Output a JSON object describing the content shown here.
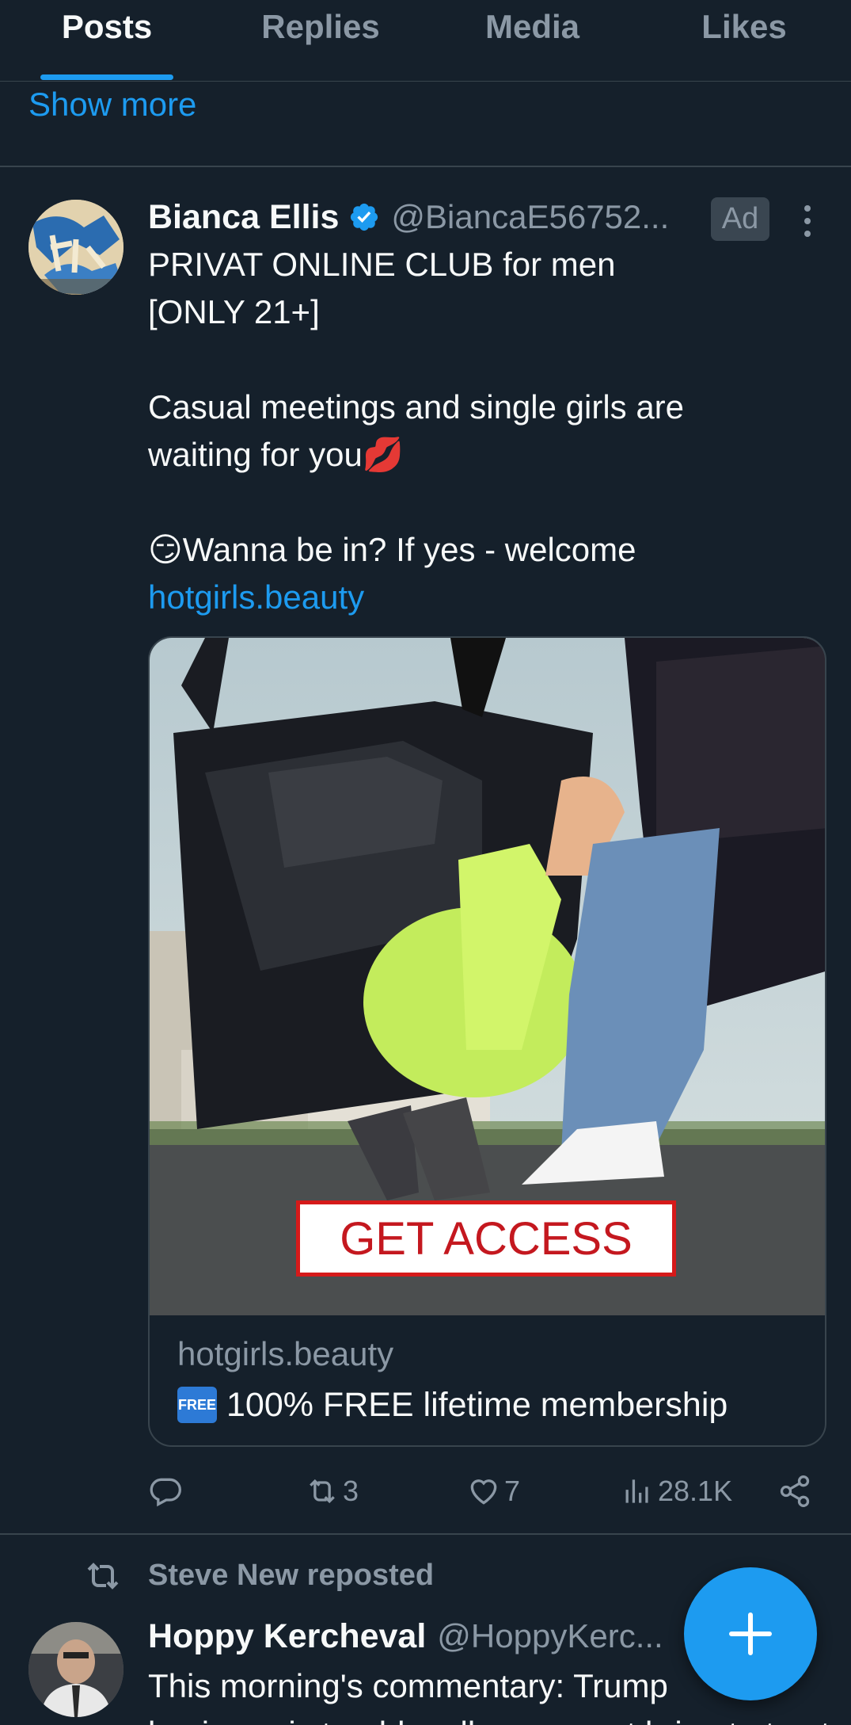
{
  "tabs": [
    {
      "label": "Posts",
      "active": true
    },
    {
      "label": "Replies",
      "active": false
    },
    {
      "label": "Media",
      "active": false
    },
    {
      "label": "Likes",
      "active": false
    }
  ],
  "show_more": "Show more",
  "ad_post": {
    "author": "Bianca Ellis",
    "verified": true,
    "handle": "@BiancaE56752...",
    "badge": "Ad",
    "text_lines": [
      "PRIVAT ONLINE CLUB for men",
      "[ONLY 21+]",
      "",
      "Casual meetings and single girls are",
      "waiting for you💋",
      "",
      "😏Wanna be in? If yes - welcome"
    ],
    "link": "hotgirls.beauty",
    "card": {
      "cta": "GET ACCESS",
      "domain": "hotgirls.beauty",
      "badge": "FREE",
      "title": "100% FREE lifetime membership"
    },
    "stats": {
      "reply_icon": "reply-icon",
      "reposts": "3",
      "likes": "7",
      "views": "28.1K",
      "share_icon": "share-icon"
    }
  },
  "repost": {
    "reposted_by": "Steve New reposted",
    "author": "Hoppy Kercheval",
    "handle": "@HoppyKerc...",
    "text_line1": "This morning's commentary: Trump",
    "text_line2": "business is trouble, all we cannot bring to trust"
  },
  "colors": {
    "background": "#15202b",
    "accent": "#1d9bf0",
    "muted": "#8b98a5",
    "divider": "#38444d"
  }
}
